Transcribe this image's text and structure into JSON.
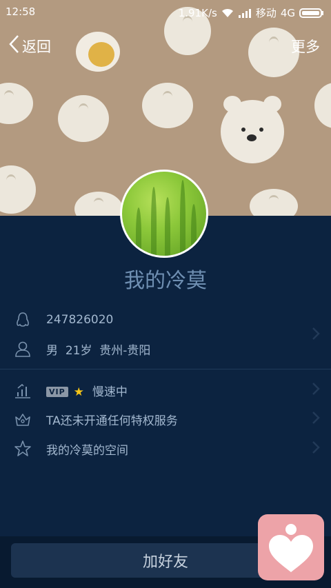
{
  "status_bar": {
    "time": "12:58",
    "speed": "1.91K/s",
    "carrier": "移动",
    "network": "4G"
  },
  "nav": {
    "back_label": "返回",
    "more_label": "更多"
  },
  "profile": {
    "nickname": "我的冷莫",
    "qq_number": "247826020",
    "gender": "男",
    "age": "21岁",
    "location": "贵州-贵阳"
  },
  "privileges": {
    "vip_badge": "VIP",
    "speed_status": "慢速中",
    "service_text": "TA还未开通任何特权服务",
    "space_text": "我的冷莫的空间"
  },
  "actions": {
    "add_friend_label": "加好友"
  },
  "colors": {
    "background": "#0c2340",
    "banner": "#b39a80",
    "accent_star": "#f5c518",
    "heart_button": "#eda3a8"
  },
  "icons": {
    "back": "chevron-left-icon",
    "qq": "penguin-icon",
    "person": "person-icon",
    "level": "level-bars-icon",
    "privilege": "crown-icon",
    "space": "star-outline-icon",
    "heart": "heart-icon"
  }
}
